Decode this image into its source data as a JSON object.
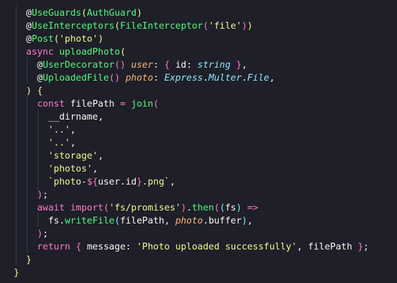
{
  "colors": {
    "background": "#1e1f29",
    "decorator": "#50fa7b",
    "keyword": "#ff79c6",
    "string": "#f1fa8c",
    "type": "#8be9fd",
    "parameter": "#ffb86c",
    "text": "#f8f8f2"
  },
  "code_lines": [
    "@UseGuards(AuthGuard)",
    "@UseInterceptors(FileInterceptor('file'))",
    "@Post('photo')",
    "async uploadPhoto(",
    "  @UserDecorator() user: { id: string },",
    "  @UploadedFile() photo: Express.Multer.File,",
    ") {",
    "  const filePath = join(",
    "    __dirname,",
    "    '..',",
    "    '..',",
    "    'storage',",
    "    'photos',",
    "    `photo-${user.id}.png`,",
    "  );",
    "  await import('fs/promises').then((fs) =>",
    "    fs.writeFile(filePath, photo.buffer),",
    "  );",
    "  return { message: 'Photo uploaded successfully', filePath };",
    "}",
    "}"
  ]
}
